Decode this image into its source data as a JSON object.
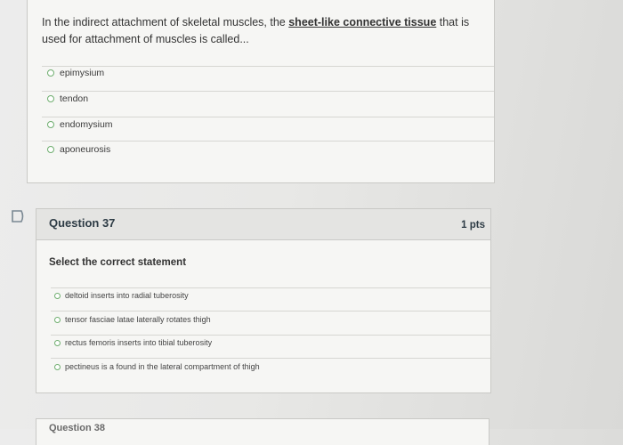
{
  "question36": {
    "text_before": "In the indirect attachment of skeletal muscles, the ",
    "text_emphasis": "sheet-like connective tissue",
    "text_after": " that is used for attachment of muscles is called...",
    "options": [
      "epimysium",
      "tendon",
      "endomysium",
      "aponeurosis"
    ]
  },
  "question37": {
    "title": "Question 37",
    "points": "1 pts",
    "prompt": "Select the correct statement",
    "options": [
      "deltoid inserts into radial tuberosity",
      "tensor fasciae latae laterally rotates thigh",
      "rectus femoris inserts into tibial tuberosity",
      "pectineus is a found in the lateral compartment of thigh"
    ]
  },
  "question38": {
    "title": "Question 38"
  },
  "colors": {
    "radio_border": "#6fae6f",
    "card_bg": "#f6f6f4",
    "header_bg": "#e4e4e2"
  },
  "icons": {
    "flag": "flag-icon"
  }
}
